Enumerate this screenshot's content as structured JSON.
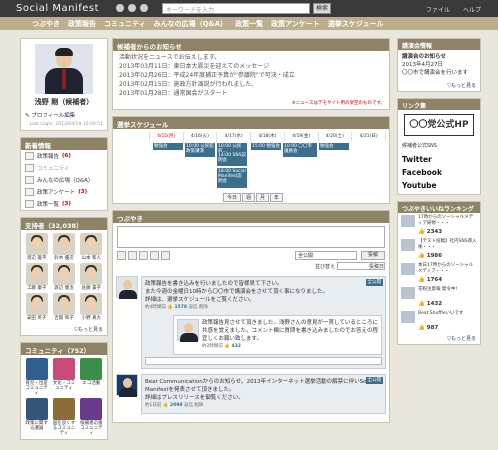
{
  "header": {
    "logo": "Social Manifest",
    "search_placeholder": "キーワードを入力",
    "search_button": "検索",
    "file_menu": "ファイル",
    "help_menu": "ヘルプ"
  },
  "nav": [
    "つぶやき",
    "政策報告",
    "コミュニティ",
    "みんなの広場（Q&A）",
    "政策一覧",
    "政策アンケート",
    "選挙スケジュール"
  ],
  "profile": {
    "name": "浅野 剛（候補者）",
    "edit_link": "プロフィール編集",
    "last_login": "Last Login: 2013/04/19 10:09:51"
  },
  "news": {
    "title": "新着情報",
    "items": [
      {
        "label": "政策報告",
        "count": "(6)"
      },
      {
        "label": "コミュニティ",
        "count": ""
      },
      {
        "label": "みんなの広場（Q&A）",
        "count": ""
      },
      {
        "label": "政策アンケート",
        "count": "(3)"
      },
      {
        "label": "政策一覧",
        "count": "(3)"
      }
    ]
  },
  "supporters": {
    "title": "支持者（32,038）",
    "people": [
      "渡辺 雄平",
      "鈴木 優次",
      "山本 和人",
      "工藤 康子",
      "渡辺 健治",
      "佐藤 貴子",
      "安田 英子",
      "吉賀 和子",
      "小野 真大"
    ],
    "more": "▽もっと見る"
  },
  "community": {
    "title": "コミュニティ（752）",
    "items": [
      {
        "label": "育児・出産コミュニティ",
        "color": "#2f5e8f"
      },
      {
        "label": "文化・コミュニティ",
        "color": "#c94b7a"
      },
      {
        "label": "エコ活動",
        "color": "#3b8f4a"
      },
      {
        "label": "政策に関する議論",
        "color": "#35557a"
      },
      {
        "label": "国を良くするコミュニティ",
        "color": "#8a6d3b"
      },
      {
        "label": "候補者応援コミュニティ",
        "color": "#6a3b8a"
      }
    ],
    "more": "▽もっと見る"
  },
  "notice": {
    "title": "候補者からのお知らせ",
    "subtitle": "活動状況をニュースでお伝えします。",
    "items": [
      "2013年03月11日：東日本大震災を迎えてのメッセージ",
      "2013年02月26日：平成24年度補正予算が\"参議院\"で可決・成立",
      "2013年02月15日：施政方針演説が行われました。",
      "2013年01月28日：通常国会がスタート"
    ],
    "note": "※ニュースはデモサイト用の架空のものです。"
  },
  "schedule": {
    "title": "選挙スケジュール",
    "days": [
      "4/15(月)",
      "4/16(火)",
      "4/17(水)",
      "4/18(木)",
      "4/19(金)",
      "4/20(土)",
      "4/21(日)"
    ],
    "events": [
      "勉強会",
      "10:00 公民館政策講演",
      "10:00 公民館...",
      "14:00 SNS説明会",
      "18:00 Social Manifest説明会",
      "15:00 勉強会",
      "10:00 〇〇市議員会",
      "勉強会"
    ],
    "nav": [
      "今日",
      "週",
      "月",
      "年"
    ]
  },
  "tweets": {
    "title": "つぶやき",
    "visibility": "全公開",
    "post_button": "投稿",
    "sort_label": "並び替え",
    "sort_value": "投稿日",
    "items": [
      {
        "lines": [
          "政策報告を書き込みを行いましたので皆様見て下さい。",
          "また今週の金曜日10時から〇〇市で講演会をさせて頂く事になりました。",
          "詳細は、選挙スケジュールをご覧ください。"
        ],
        "badge": "全公開",
        "meta": "約4時間前",
        "likes": "1578",
        "actions": "返信 削除"
      },
      {
        "lines": [
          "政策報告見させて頂きました。浅野さんの意見が一貫しているところに共感を覚えました。コメント欄に質問を書き込みましたのでお答えの程宜しくお願い致します。"
        ],
        "meta": "約2時間前",
        "likes": "432"
      },
      {
        "lines": [
          "Beat Communicationからのお知らせ。2013年インターネット選挙活動の解禁に伴いSocial Manifestを発表させて頂きました。",
          "詳細はプレスリリースを御覧ください。"
        ],
        "badge": "全公開",
        "meta": "約1日前",
        "likes": "2098",
        "actions": "返信 削除"
      }
    ]
  },
  "meeting": {
    "title": "講演会情報",
    "heading": "講演会のお知らせ",
    "date": "2013年4月27日",
    "place": "〇〇市で講演会を行います",
    "more": "▽もっと見る"
  },
  "links": {
    "title": "リンク集",
    "hp": "〇〇党公式HP",
    "sns_label": "候補者公式SNS",
    "sns": [
      "Twitter",
      "Facebook",
      "Youtube"
    ]
  },
  "ranking": {
    "title": "つぶやきいいねランキング",
    "items": [
      {
        "text": "17時からのソーシャルメディア研修・・・",
        "count": "2343"
      },
      {
        "text": "【テスト投稿】社内SNS導入後・・・",
        "count": "1986"
      },
      {
        "text": "本日17時からのソーシャルメディア・・・",
        "count": "1764"
      },
      {
        "text": "花粉注意報 発令中！",
        "count": "1432"
      },
      {
        "text": "Beat Shuffleいいです",
        "count": "987"
      }
    ],
    "more": "▽もっと見る"
  },
  "colors": {
    "brand": "#8e8366",
    "topbar": "#3a3a3a",
    "accent": "#3c6e8e",
    "alert": "#cc0000"
  }
}
